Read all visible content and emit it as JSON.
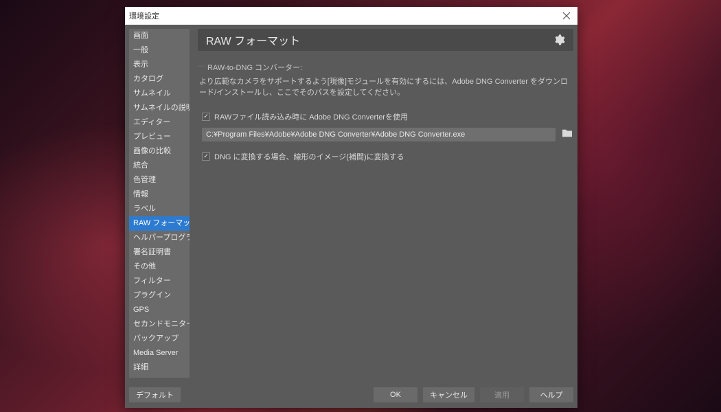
{
  "dialog": {
    "title": "環境設定"
  },
  "sidebar": {
    "items": [
      {
        "label": "画面"
      },
      {
        "label": "一般"
      },
      {
        "label": "表示"
      },
      {
        "label": "カタログ"
      },
      {
        "label": "サムネイル"
      },
      {
        "label": "サムネイルの説明"
      },
      {
        "label": "エディター"
      },
      {
        "label": "プレビュー"
      },
      {
        "label": "画像の比較"
      },
      {
        "label": "統合"
      },
      {
        "label": "色管理"
      },
      {
        "label": "情報"
      },
      {
        "label": "ラベル"
      },
      {
        "label": "RAW フォーマット"
      },
      {
        "label": "ヘルパープログラム"
      },
      {
        "label": "署名証明書"
      },
      {
        "label": "その他"
      },
      {
        "label": "フィルター"
      },
      {
        "label": "プラグイン"
      },
      {
        "label": "GPS"
      },
      {
        "label": "セカンドモニター"
      },
      {
        "label": "バックアップ"
      },
      {
        "label": "Media Server"
      },
      {
        "label": "詳細"
      }
    ],
    "selected_index": 13
  },
  "header": {
    "title": "RAW フォーマット"
  },
  "panel": {
    "section_title": "RAW-to-DNG コンバーター:",
    "description": "より広範なカメラをサポートするよう[現像]モジュールを有効にするには、Adobe DNG Converter をダウンロード/インストールし、ここでそのパスを設定してください。",
    "check1_label": "RAWファイル読み込み時に Adobe DNG Converterを使用",
    "check1_checked": true,
    "path_value": "C:¥Program Files¥Adobe¥Adobe DNG Converter¥Adobe DNG Converter.exe",
    "check2_label": "DNG に変換する場合、線形のイメージ(補間)に変換する",
    "check2_checked": true
  },
  "footer": {
    "default": "デフォルト",
    "ok": "OK",
    "cancel": "キャンセル",
    "apply": "適用",
    "help": "ヘルプ"
  }
}
